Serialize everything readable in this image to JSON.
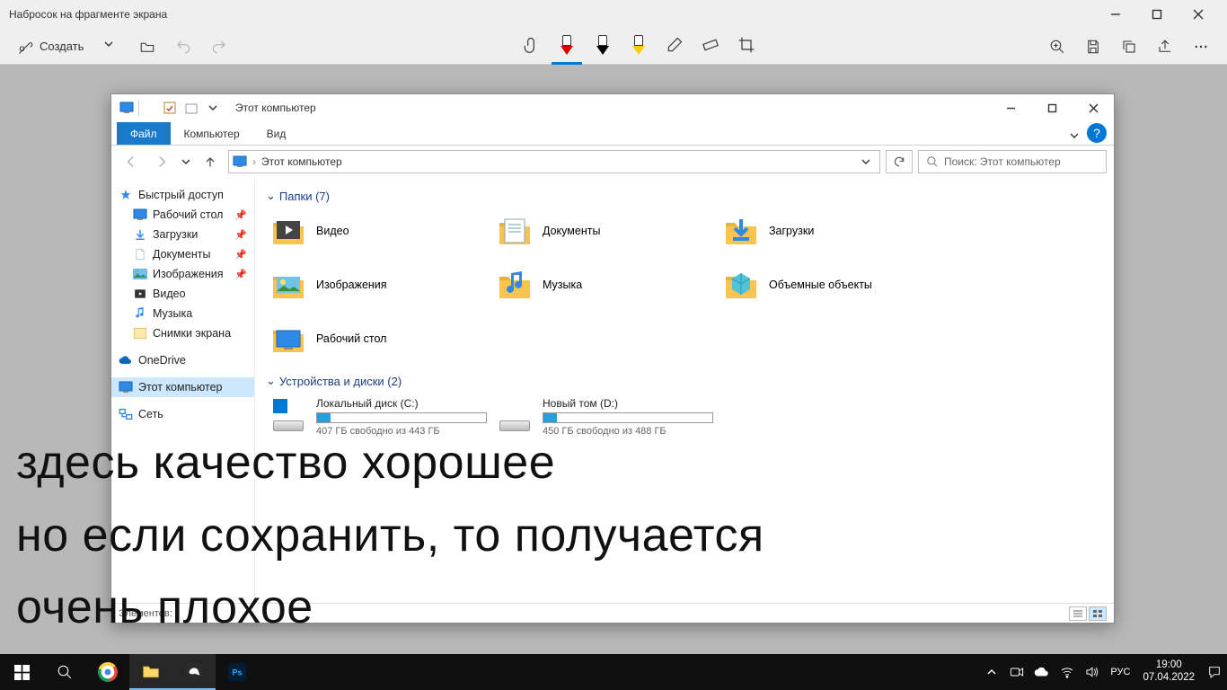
{
  "app": {
    "title": "Набросок на фрагменте экрана",
    "new_label": "Создать"
  },
  "explorer": {
    "title": "Этот компьютер",
    "ribbon": {
      "file": "Файл",
      "computer": "Компьютер",
      "view": "Вид"
    },
    "breadcrumb": "Этот компьютер",
    "search_placeholder": "Поиск: Этот компьютер",
    "sidebar": {
      "quick_access": "Быстрый доступ",
      "items": [
        {
          "label": "Рабочий стол",
          "pinned": true
        },
        {
          "label": "Загрузки",
          "pinned": true
        },
        {
          "label": "Документы",
          "pinned": true
        },
        {
          "label": "Изображения",
          "pinned": true
        },
        {
          "label": "Видео",
          "pinned": false
        },
        {
          "label": "Музыка",
          "pinned": false
        },
        {
          "label": "Снимки экрана",
          "pinned": false
        }
      ],
      "onedrive": "OneDrive",
      "this_pc": "Этот компьютер",
      "network": "Сеть"
    },
    "groups": {
      "folders_label": "Папки (7)",
      "folders": [
        "Видео",
        "Документы",
        "Загрузки",
        "Изображения",
        "Музыка",
        "Объемные объекты",
        "Рабочий стол"
      ],
      "drives_label": "Устройства и диски (2)",
      "drives": [
        {
          "name": "Локальный диск (C:)",
          "free": "407 ГБ свободно из 443 ГБ",
          "fill_pct": 8
        },
        {
          "name": "Новый том (D:)",
          "free": "450 ГБ свободно из 488 ГБ",
          "fill_pct": 8
        }
      ]
    },
    "status": "Элементов:"
  },
  "overlay": {
    "line1": "здесь качество хорошее",
    "line2": "но если сохранить, то получается",
    "line3": "очень плохое"
  },
  "taskbar": {
    "lang": "РУС",
    "time": "19:00",
    "date": "07.04.2022"
  }
}
